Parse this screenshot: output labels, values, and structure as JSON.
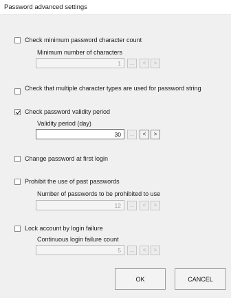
{
  "window": {
    "title": "Password advanced settings"
  },
  "options": [
    {
      "label": "Check minimum password character count",
      "checked": false,
      "sub_label": "Minimum number of characters",
      "value": "1",
      "enabled": false
    },
    {
      "label": "Check that multiple character types are used for password string",
      "checked": false
    },
    {
      "label": "Check password validity period",
      "checked": true,
      "sub_label": "Validity period (day)",
      "value": "30",
      "enabled": true
    },
    {
      "label": "Change password at first login",
      "checked": false
    },
    {
      "label": "Prohibit the use of past passwords",
      "checked": false,
      "sub_label": "Number of passwords to be prohibited to use",
      "value": "12",
      "enabled": false
    },
    {
      "label": "Lock account by login failure",
      "checked": false,
      "sub_label": "Continuous login failure count",
      "value": "5",
      "enabled": false
    }
  ],
  "stepper": {
    "ellipsis": "...",
    "decrement": "<",
    "increment": ">"
  },
  "buttons": {
    "ok": "OK",
    "cancel": "CANCEL"
  }
}
